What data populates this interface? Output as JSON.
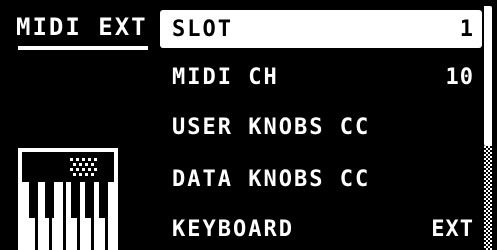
{
  "panel": {
    "title": "MIDI EXT"
  },
  "menu": {
    "items": [
      {
        "label": "SLOT",
        "value": "1",
        "selected": true
      },
      {
        "label": "MIDI CH",
        "value": "10",
        "selected": false
      },
      {
        "label": "USER KNOBS CC",
        "value": "",
        "selected": false
      },
      {
        "label": "DATA KNOBS CC",
        "value": "",
        "selected": false
      },
      {
        "label": "KEYBOARD",
        "value": "EXT",
        "selected": false
      }
    ]
  },
  "icons": {
    "panel_icon": "piano-keyboard-icon"
  },
  "colors": {
    "background": "#000000",
    "foreground": "#ffffff"
  }
}
